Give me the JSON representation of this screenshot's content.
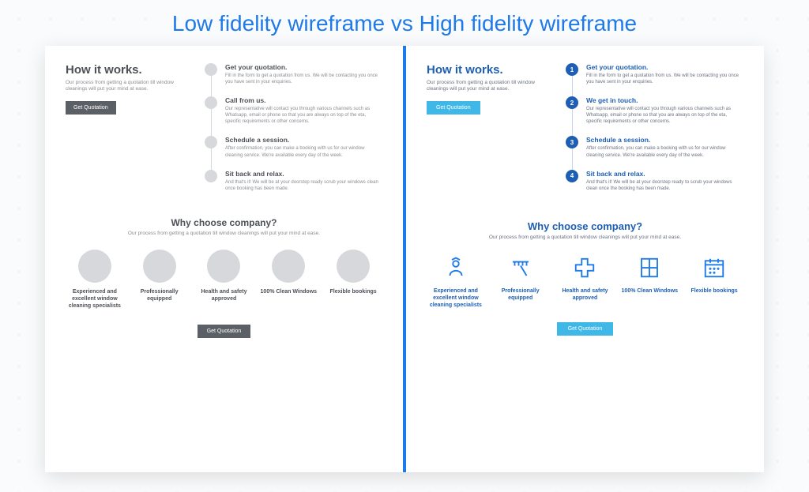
{
  "page": {
    "title": "Low fidelity wireframe vs High fidelity wireframe"
  },
  "lowfi": {
    "hiw_title": "How it works.",
    "hiw_sub": "Our process from getting a quotation till window cleanings will put your mind at ease.",
    "cta": "Get Quotation",
    "steps": [
      {
        "title": "Get your quotation.",
        "desc": "Fill in the form to get a quotation from us. We will be contacting you once you have sent in your enquiries."
      },
      {
        "title": "Call from us.",
        "desc": "Our representative will contact you through various channels such as Whatsapp, email or phone so that you are always on top of the eta, specific requirements or other concerns."
      },
      {
        "title": "Schedule a session.",
        "desc": "After confirmation, you can make a booking with us for our window cleaning service. We're available every day of the week."
      },
      {
        "title": "Sit back and relax.",
        "desc": "And that's it! We will be at your doorstep ready scrub your windows clean once booking has been made."
      }
    ],
    "why_title": "Why choose company?",
    "why_sub": "Our process from getting a quotation till window cleanings will put your mind at ease.",
    "features": [
      "Experienced and excellent window cleaning specialists",
      "Professionally equipped",
      "Health and safety approved",
      "100% Clean Windows",
      "Flexible bookings"
    ],
    "cta2": "Get Quotation"
  },
  "hifi": {
    "hiw_title": "How it works.",
    "hiw_sub": "Our process from getting a quotation till window cleanings will put your mind at ease.",
    "cta": "Get Quotation",
    "steps": [
      {
        "num": "1",
        "title": "Get your quotation.",
        "desc": "Fill in the form to get a quotation from us. We will be contacting you once you have sent in your enquiries."
      },
      {
        "num": "2",
        "title": "We get in touch.",
        "desc": "Our representative will contact you through various channels such as Whatsapp, email or phone so that you are always on top of the eta, specific requirements or other concerns."
      },
      {
        "num": "3",
        "title": "Schedule a session.",
        "desc": "After confirmation, you can make a booking with us for our window cleaning service. We're available every day of the week."
      },
      {
        "num": "4",
        "title": "Sit back and relax.",
        "desc": "And that's it! We will be at your doorstep ready to scrub your windows clean once the booking has been made."
      }
    ],
    "why_title": "Why choose company?",
    "why_sub": "Our process from getting a quotation till window cleanings will put your mind at ease.",
    "features": [
      "Experienced and excellent window cleaning specialists",
      "Professionally equipped",
      "Health and safety approved",
      "100% Clean Windows",
      "Flexible bookings"
    ],
    "cta2": "Get Quotation"
  }
}
